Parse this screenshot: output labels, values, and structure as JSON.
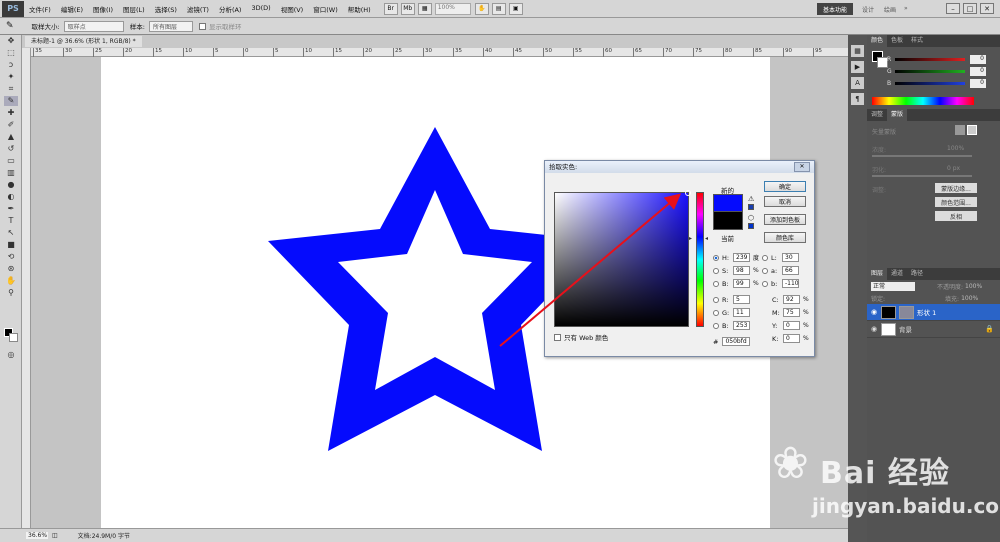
{
  "menubar": {
    "logo": "PS",
    "items": [
      "文件(F)",
      "编辑(E)",
      "图像(I)",
      "图层(L)",
      "选择(S)",
      "滤镜(T)",
      "分析(A)",
      "3D(D)",
      "视图(V)",
      "窗口(W)",
      "帮助(H)"
    ],
    "zoom": "100%",
    "workspace": "基本功能",
    "links": [
      "设计",
      "绘画"
    ]
  },
  "options": {
    "sample_size_label": "取样大小:",
    "sample_size_value": "取样点",
    "sample_label": "样本:",
    "sample_value": "所有图层",
    "show_ring": "显示取样环"
  },
  "document": {
    "tab": "未标题-1 @ 36.6% (形状 1, RGB/8) *",
    "ruler_ticks": [
      "35",
      "30",
      "25",
      "20",
      "15",
      "10",
      "5",
      "0",
      "5",
      "10",
      "15",
      "20",
      "25",
      "30",
      "35",
      "40",
      "45",
      "50",
      "55",
      "60",
      "65",
      "70",
      "75",
      "80",
      "85",
      "90",
      "95"
    ],
    "star_color": "#050bfd"
  },
  "status": {
    "zoom": "36.6%",
    "doc": "文档:24.9M/0 字节"
  },
  "panels": {
    "color_tabs": [
      "颜色",
      "色板",
      "样式"
    ],
    "rgb": [
      {
        "label": "R",
        "value": "0",
        "color": "#e02020"
      },
      {
        "label": "G",
        "value": "0",
        "color": "#20b020"
      },
      {
        "label": "B",
        "value": "0",
        "color": "#2040e0"
      }
    ],
    "adjust_tabs": [
      "调整",
      "蒙版"
    ],
    "mask_title": "矢量蒙版",
    "density_label": "浓度:",
    "density_value": "100%",
    "feather_label": "羽化:",
    "feather_value": "0 px",
    "refine_label": "调整:",
    "refine_buttons": [
      "蒙版边缘...",
      "颜色范围...",
      "反相"
    ],
    "layer_tabs": [
      "图层",
      "通道",
      "路径"
    ],
    "blend_mode": "正常",
    "opacity_label": "不透明度:",
    "opacity_value": "100%",
    "lock_label": "锁定:",
    "fill_label": "填充:",
    "fill_value": "100%",
    "layers": [
      {
        "name": "形状 1",
        "active": true
      },
      {
        "name": "背景",
        "active": false
      }
    ]
  },
  "dialog": {
    "title": "拾取实色:",
    "new_label": "新的",
    "current_label": "当前",
    "new_color": "#050bfd",
    "current_color": "#000000",
    "buttons": [
      "确定",
      "取消",
      "添加到色板",
      "颜色库"
    ],
    "web_only": "只有 Web 颜色",
    "fields_left": [
      {
        "label": "H:",
        "value": "239",
        "unit": "度",
        "checked": true
      },
      {
        "label": "S:",
        "value": "98",
        "unit": "%",
        "checked": false
      },
      {
        "label": "B:",
        "value": "99",
        "unit": "%",
        "checked": false
      },
      {
        "label": "R:",
        "value": "5",
        "unit": "",
        "checked": false
      },
      {
        "label": "G:",
        "value": "11",
        "unit": "",
        "checked": false
      },
      {
        "label": "B:",
        "value": "253",
        "unit": "",
        "checked": false
      }
    ],
    "fields_right": [
      {
        "label": "L:",
        "value": "30"
      },
      {
        "label": "a:",
        "value": "66"
      },
      {
        "label": "b:",
        "value": "-110"
      }
    ],
    "cmyk": [
      {
        "label": "C:",
        "value": "92",
        "unit": "%"
      },
      {
        "label": "M:",
        "value": "75",
        "unit": "%"
      },
      {
        "label": "Y:",
        "value": "0",
        "unit": "%"
      },
      {
        "label": "K:",
        "value": "0",
        "unit": "%"
      }
    ],
    "hex": "050bfd"
  },
  "watermark": {
    "brand": "Bai 经验",
    "domain": "jingyan.baidu.com"
  }
}
